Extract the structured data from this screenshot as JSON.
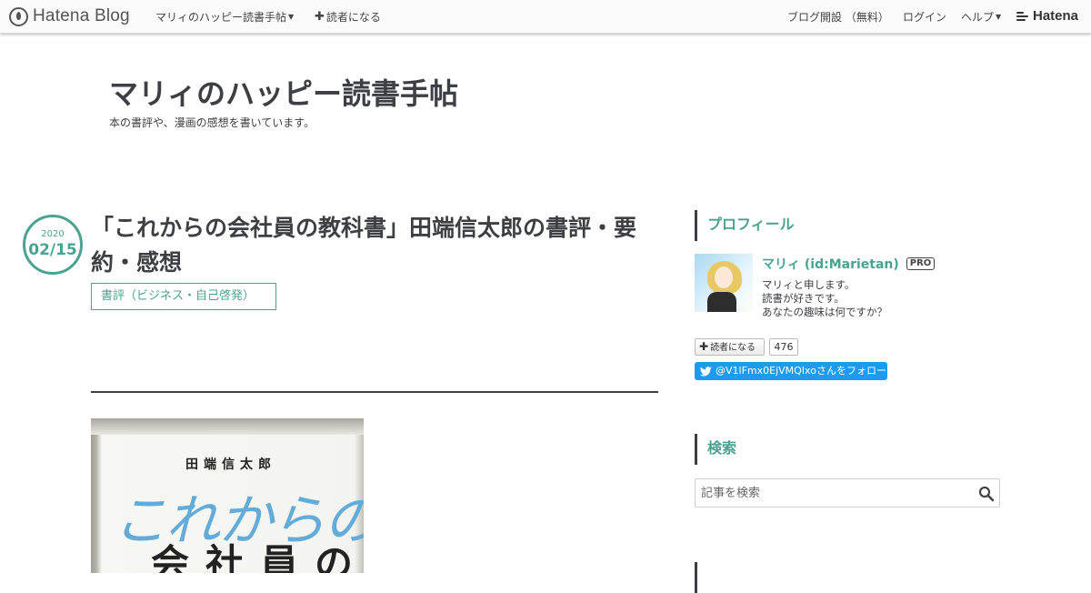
{
  "topbar": {
    "brand": "Hatena Blog",
    "blog_menu": "マリィのハッピー読書手帖",
    "subscribe": "読者になる",
    "open_blog": "ブログ開設 （無料）",
    "login": "ログイン",
    "help": "ヘルプ",
    "hatena": "Hatena"
  },
  "blog": {
    "title": "マリィのハッピー読書手帖",
    "description": "本の書評や、漫画の感想を書いています。"
  },
  "entry": {
    "year": "2020",
    "month_day": "02/15",
    "title": "「これからの会社員の教科書」田端信太郎の書評・要約・感想",
    "category": "書評（ビジネス・自己啓発）",
    "cover": {
      "author": "田端信太郎",
      "script_title": "これからの",
      "main_title": "会社員の"
    }
  },
  "sidebar": {
    "profile": {
      "heading": "プロフィール",
      "name": "マリィ (id:Marietan)",
      "badge": "PRO",
      "bio_line1": "マリィと申します。",
      "bio_line2": "読書が好きです。",
      "bio_line3": "あなたの趣味は何ですか？",
      "subscribe_label": "読者になる",
      "subscriber_count": "476",
      "twitter_follow": "@V1lFmx0EjVMQIxoさんをフォロー"
    },
    "search": {
      "heading": "検索",
      "placeholder": "記事を検索"
    }
  },
  "colors": {
    "accent": "#4aa392",
    "text": "#3d3f44",
    "twitter": "#1d9bf0"
  },
  "icons": [
    "hatena-blog-logo-icon",
    "plus-icon",
    "caret-down-icon",
    "hatena-logo-icon",
    "twitter-bird-icon",
    "search-icon"
  ]
}
